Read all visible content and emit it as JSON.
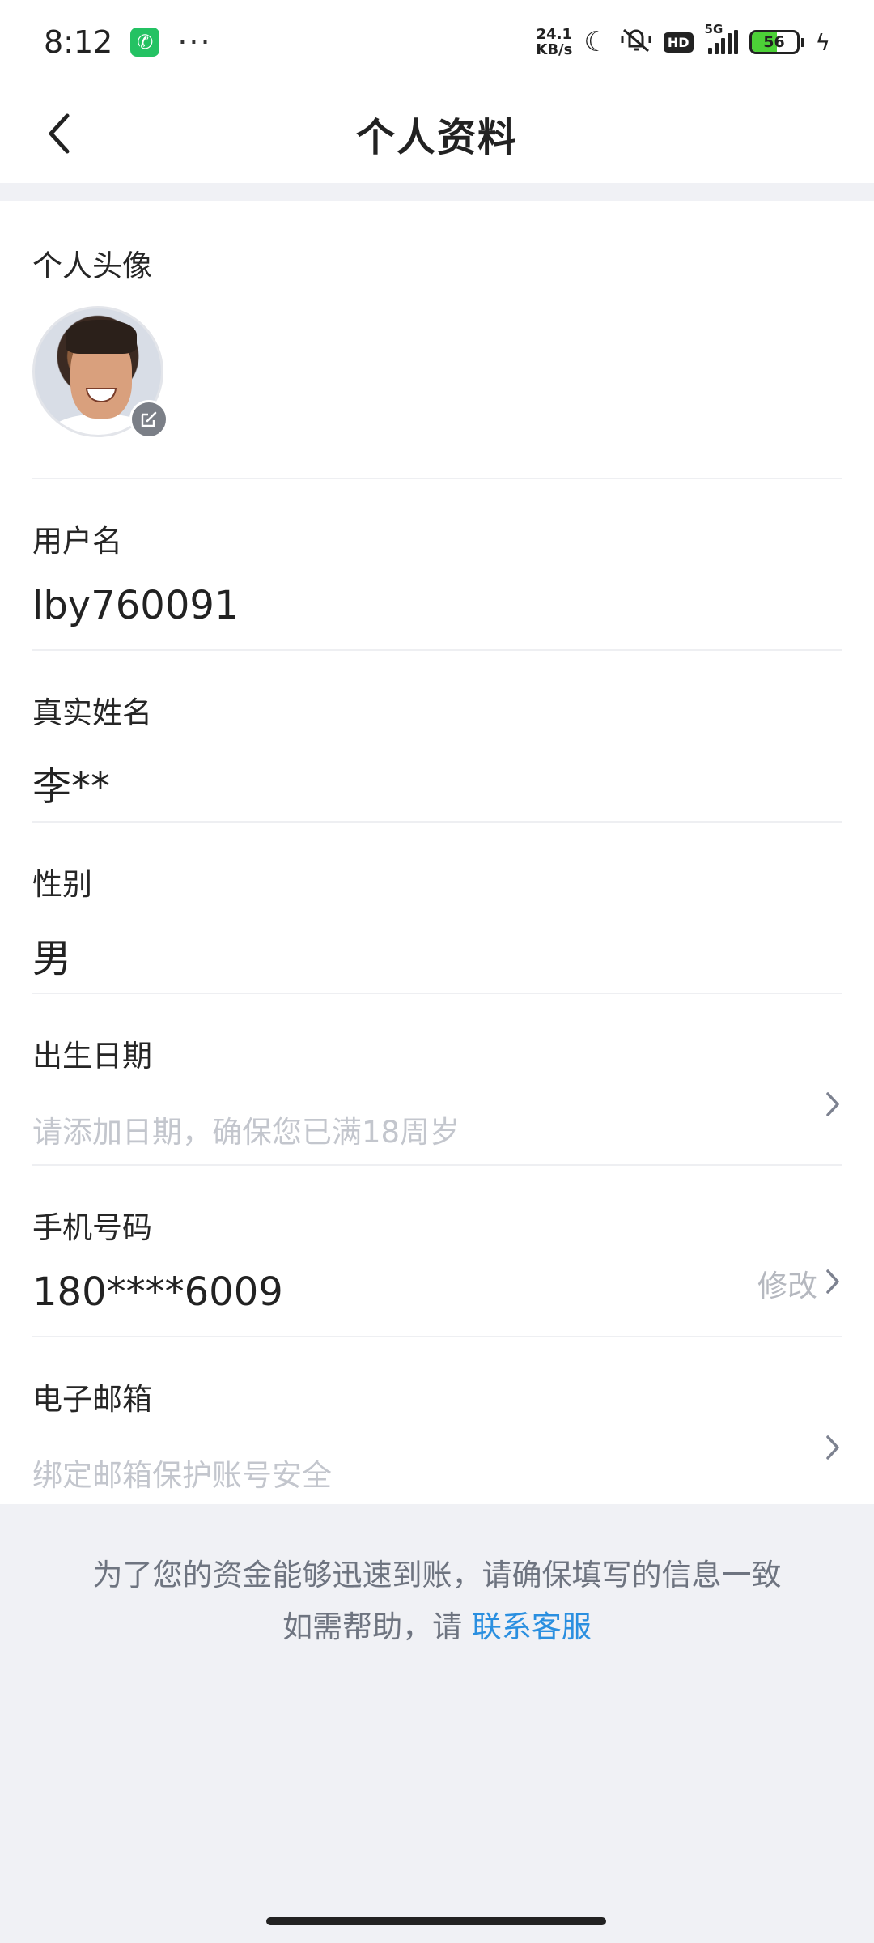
{
  "status_bar": {
    "time": "8:12",
    "more": "···",
    "net_speed_top": "24.1",
    "net_speed_bottom": "KB/s",
    "hd": "HD",
    "network": "5G",
    "battery": "56",
    "battery_level": 0.56,
    "icons": [
      "phone-call-icon",
      "moon-icon",
      "mute-vibrate-icon",
      "hd-icon",
      "signal-icon",
      "battery-icon",
      "charging-bolt-icon"
    ]
  },
  "header": {
    "title": "个人资料",
    "back_icon": "chevron-left-icon"
  },
  "profile": {
    "avatar_label": "个人头像",
    "username": {
      "label": "用户名",
      "value": "lby760091"
    },
    "real_name": {
      "label": "真实姓名",
      "value": "李**"
    },
    "gender": {
      "label": "性别",
      "value": "男"
    },
    "birthday": {
      "label": "出生日期",
      "placeholder": "请添加日期，确保您已满18周岁"
    },
    "phone": {
      "label": "手机号码",
      "value": "180****6009",
      "action": "修改"
    },
    "email": {
      "label": "电子邮箱",
      "placeholder": "绑定邮箱保护账号安全"
    }
  },
  "footer": {
    "notice_line1": "为了您的资金能够迅速到账，请确保填写的信息一致",
    "notice_line2_prefix": "如需帮助，请 ",
    "contact_link": "联系客服"
  },
  "colors": {
    "background_band": "#f0f1f5",
    "link": "#2a8fe0",
    "placeholder": "#c3c6cd",
    "battery_green": "#4cd137"
  }
}
